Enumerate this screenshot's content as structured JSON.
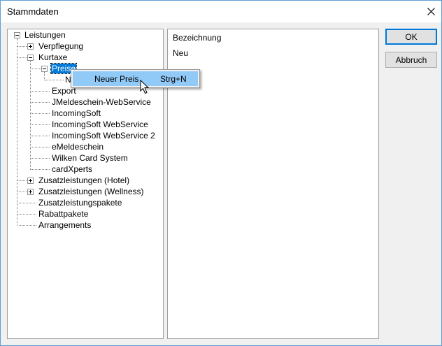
{
  "window": {
    "title": "Stammdaten",
    "accent": "#0078d7"
  },
  "buttons": {
    "ok": "OK",
    "cancel": "Abbruch"
  },
  "detail": {
    "header": "Bezeichnung",
    "value": "Neu"
  },
  "tree": {
    "root": "Leistungen",
    "verpflegung": "Verpflegung",
    "kurtaxe": "Kurtaxe",
    "preise": "Preise",
    "hidden_child": "N",
    "export": "Export",
    "jmeldeschein": "JMeldeschein-WebService",
    "incomingsoft": "IncomingSoft",
    "incomingsoft_ws": "IncomingSoft WebService",
    "incomingsoft_ws2": "IncomingSoft WebService 2",
    "emeldeschein": "eMeldeschein",
    "wilken": "Wilken Card System",
    "cardxperts": "cardXperts",
    "zusatz_hotel": "Zusatzleistungen (Hotel)",
    "zusatz_wellness": "Zusatzleistungen (Wellness)",
    "zusatzpakete": "Zusatzleistungspakete",
    "rabattpakete": "Rabattpakete",
    "arrangements": "Arrangements"
  },
  "context_menu": {
    "item_label": "Neuer Preis",
    "item_shortcut": "Strg+N"
  }
}
